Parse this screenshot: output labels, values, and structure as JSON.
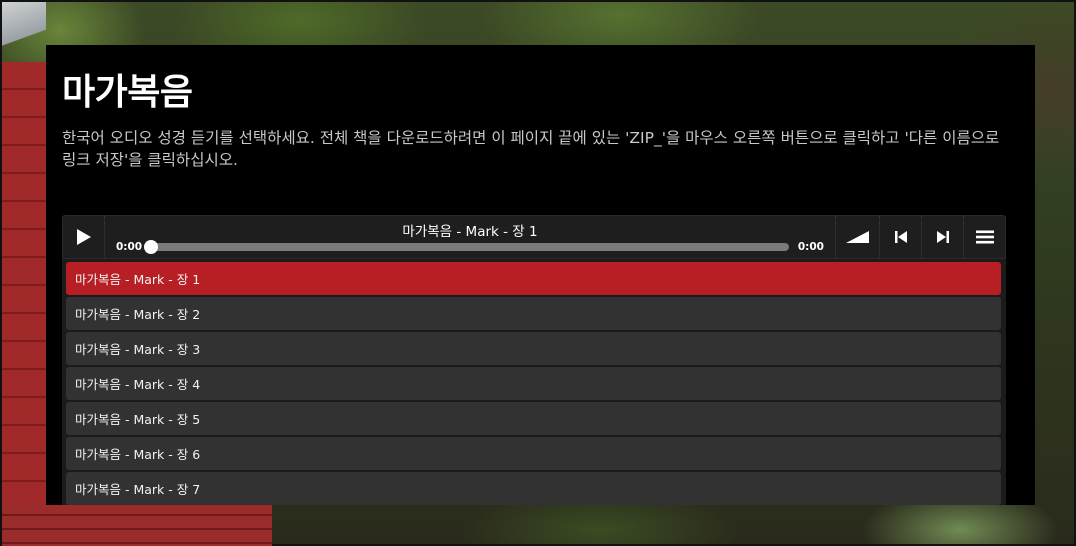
{
  "page": {
    "title": "마가복음",
    "intro": "한국어 오디오 성경 듣기를 선택하세요. 전체 책을 다운로드하려면 이 페이지 끝에 있는 'ZIP_'을 마우스 오른쪽 버튼으로 클릭하고 '다른 이름으로 링크 저장'을 클릭하십시오."
  },
  "player": {
    "now_playing": "마가복음 - Mark - 장 1",
    "current_time": "0:00",
    "duration": "0:00",
    "progress": 0,
    "icons": {
      "play": "play-icon",
      "volume": "volume-icon",
      "prev": "previous-track-icon",
      "next": "next-track-icon",
      "menu": "playlist-menu-icon"
    }
  },
  "playlist": {
    "active_index": 0,
    "items": [
      "마가복음 - Mark - 장 1",
      "마가복음 - Mark - 장 2",
      "마가복음 - Mark - 장 3",
      "마가복음 - Mark - 장 4",
      "마가복음 - Mark - 장 5",
      "마가복음 - Mark - 장 6",
      "마가복음 - Mark - 장 7"
    ]
  },
  "colors": {
    "active_item": "#b81f25",
    "item": "#323232",
    "panel": "#000000"
  }
}
